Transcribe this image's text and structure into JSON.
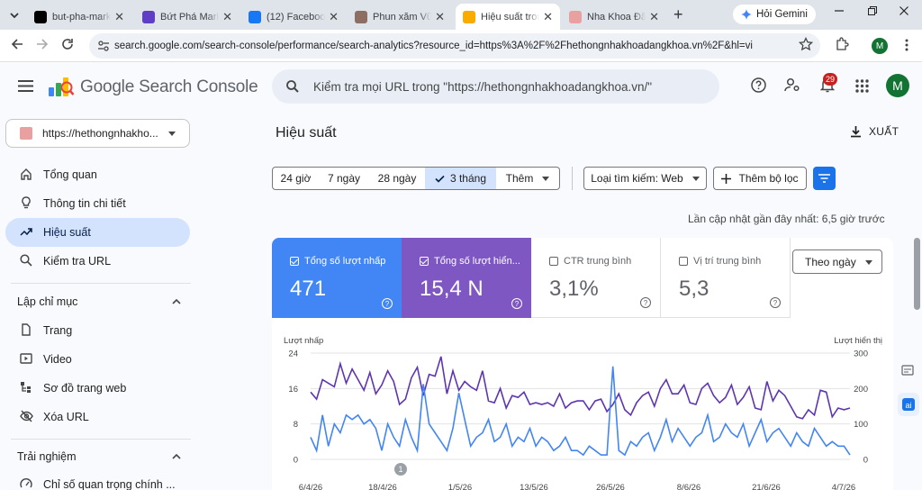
{
  "browser": {
    "tabs": [
      {
        "title": "but-pha-marke",
        "favicon_color": "#000000"
      },
      {
        "title": "Bứt Phá Marke",
        "favicon_color": "#5f3dc4"
      },
      {
        "title": "(12) Facebook",
        "favicon_color": "#1877f2"
      },
      {
        "title": "Phun xăm Vũng",
        "favicon_color": "#8d6e63"
      },
      {
        "title": "Hiệu suất trong",
        "favicon_color": "#f9ab00",
        "active": true
      },
      {
        "title": "Nha Khoa Đăng",
        "favicon_color": "#e8a0a0"
      }
    ],
    "new_tab": "+",
    "gemini_label": "Hỏi Gemini",
    "url": "search.google.com/search-console/performance/search-analytics?resource_id=https%3A%2F%2Fhethongnhakhoadangkhoa.vn%2F&hl=vi",
    "profile_initial": "M"
  },
  "header": {
    "app_name": "Google Search Console",
    "search_placeholder": "Kiểm tra mọi URL trong \"https://hethongnhakhoadangkhoa.vn/\"",
    "notification_count": "29",
    "avatar_initial": "M"
  },
  "sidebar": {
    "property": "https://hethongnhakho...",
    "items": [
      {
        "label": "Tổng quan"
      },
      {
        "label": "Thông tin chi tiết"
      },
      {
        "label": "Hiệu suất",
        "active": true
      },
      {
        "label": "Kiểm tra URL"
      }
    ],
    "section_index": "Lập chỉ mục",
    "index_items": [
      {
        "label": "Trang"
      },
      {
        "label": "Video"
      },
      {
        "label": "Sơ đồ trang web"
      },
      {
        "label": "Xóa URL"
      }
    ],
    "section_experience": "Trải nghiệm",
    "experience_items": [
      {
        "label": "Chỉ số quan trọng chính ..."
      }
    ]
  },
  "main": {
    "title": "Hiệu suất",
    "export_label": "XUẤT",
    "date_chips": [
      "24 giờ",
      "7 ngày",
      "28 ngày",
      "3 tháng",
      "Thêm"
    ],
    "selected_chip": "3 tháng",
    "search_type": "Loại tìm kiếm: Web",
    "add_filter": "Thêm bộ lọc",
    "last_update": "Lần cập nhật gần đây nhất: 6,5 giờ trước",
    "metrics": [
      {
        "label": "Tổng số lượt nhấp",
        "value": "471",
        "checked": true,
        "color": "#4285f4"
      },
      {
        "label": "Tổng số lượt hiển...",
        "value": "15,4 N",
        "checked": true,
        "color": "#7e57c2"
      },
      {
        "label": "CTR trung bình",
        "value": "3,1%",
        "checked": false
      },
      {
        "label": "Vị trí trung bình",
        "value": "5,3",
        "checked": false
      }
    ],
    "group_by": "Theo ngày",
    "annotation_marker": "1"
  },
  "chart_data": {
    "type": "line",
    "ylabel_left": "Lượt nhấp",
    "ylabel_right": "Lượt hiển thị",
    "y_left_ticks": [
      "24",
      "16",
      "8",
      "0"
    ],
    "y_right_ticks": [
      "300",
      "200",
      "100",
      "0"
    ],
    "ylim_left": [
      0,
      24
    ],
    "ylim_right": [
      0,
      300
    ],
    "x_ticks": [
      "6/4/26",
      "18/4/26",
      "1/5/26",
      "13/5/26",
      "26/5/26",
      "8/6/26",
      "21/6/26",
      "4/7/26"
    ],
    "series": [
      {
        "name": "Lượt nhấp",
        "axis": "left",
        "color": "#4285f4",
        "values": [
          5,
          2,
          10,
          3,
          8,
          6,
          10,
          9,
          10,
          8,
          9,
          7,
          2,
          8,
          5,
          3,
          9,
          5,
          2,
          17,
          8,
          6,
          4,
          2,
          7,
          15,
          9,
          3,
          5,
          6,
          9,
          4,
          5,
          8,
          3,
          5,
          4,
          7,
          3,
          5,
          4,
          2,
          3,
          5,
          2,
          2,
          1,
          3,
          2,
          1,
          1,
          21,
          2,
          1,
          4,
          3,
          5,
          6,
          2,
          5,
          9,
          4,
          7,
          5,
          3,
          5,
          6,
          10,
          4,
          5,
          8,
          6,
          5,
          8,
          3,
          6,
          9,
          4,
          6,
          7,
          5,
          3,
          6,
          4,
          3,
          7,
          5,
          3,
          4,
          3,
          3,
          1
        ]
      },
      {
        "name": "Lượt hiển thị",
        "axis": "right",
        "color": "#5e35b1",
        "values": [
          190,
          170,
          225,
          215,
          205,
          270,
          215,
          255,
          225,
          195,
          245,
          185,
          210,
          250,
          220,
          155,
          170,
          230,
          260,
          180,
          240,
          235,
          290,
          185,
          250,
          195,
          220,
          205,
          195,
          250,
          165,
          160,
          200,
          145,
          180,
          175,
          190,
          155,
          160,
          155,
          160,
          150,
          185,
          145,
          160,
          165,
          165,
          140,
          165,
          170,
          135,
          155,
          185,
          140,
          125,
          160,
          180,
          190,
          150,
          200,
          225,
          185,
          185,
          210,
          160,
          155,
          200,
          215,
          180,
          160,
          175,
          210,
          155,
          175,
          205,
          145,
          140,
          220,
          165,
          195,
          180,
          150,
          120,
          115,
          140,
          125,
          195,
          190,
          120,
          145,
          140,
          145
        ]
      }
    ]
  }
}
